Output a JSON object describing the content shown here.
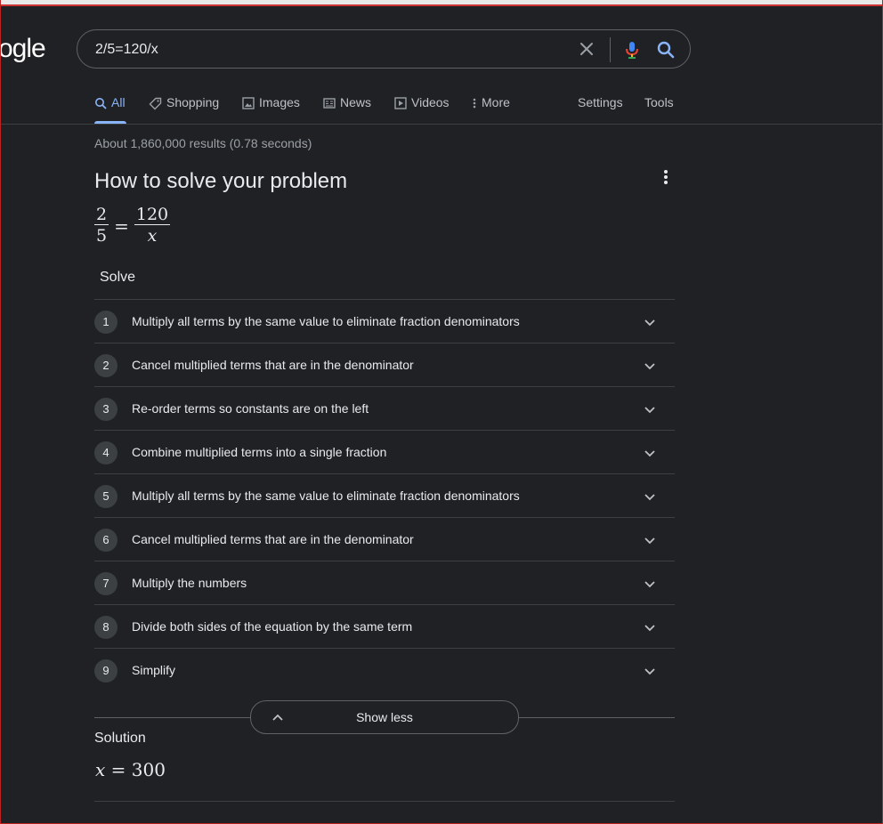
{
  "logo": {
    "text": "ogle"
  },
  "search": {
    "query": "2/5=120/x"
  },
  "tabs": [
    {
      "label": "All",
      "icon": "search-icon"
    },
    {
      "label": "Shopping",
      "icon": "tag-icon"
    },
    {
      "label": "Images",
      "icon": "image-icon"
    },
    {
      "label": "News",
      "icon": "news-icon"
    },
    {
      "label": "Videos",
      "icon": "play-icon"
    },
    {
      "label": "More",
      "icon": "more-vert-icon"
    }
  ],
  "tools": {
    "settings": "Settings",
    "tools": "Tools"
  },
  "stats": "About 1,860,000 results (0.78 seconds)",
  "panel": {
    "title": "How to solve your problem",
    "equation": {
      "lhs_num": "2",
      "lhs_den": "5",
      "eq": "=",
      "rhs_num": "120",
      "rhs_den": "x"
    },
    "solve_label": "Solve",
    "steps": [
      {
        "n": "1",
        "text": "Multiply all terms by the same value to eliminate fraction denominators"
      },
      {
        "n": "2",
        "text": "Cancel multiplied terms that are in the denominator"
      },
      {
        "n": "3",
        "text": "Re-order terms so constants are on the left"
      },
      {
        "n": "4",
        "text": "Combine multiplied terms into a single fraction"
      },
      {
        "n": "5",
        "text": "Multiply all terms by the same value to eliminate fraction denominators"
      },
      {
        "n": "6",
        "text": "Cancel multiplied terms that are in the denominator"
      },
      {
        "n": "7",
        "text": "Multiply the numbers"
      },
      {
        "n": "8",
        "text": "Divide both sides of the equation by the same term"
      },
      {
        "n": "9",
        "text": "Simplify"
      }
    ],
    "show_less": "Show less",
    "solution_label": "Solution",
    "solution": {
      "var": "x",
      "eq": "=",
      "value": "300"
    }
  },
  "colors": {
    "background": "#202124",
    "accent": "#8ab4f8",
    "text": "#e8eaed",
    "muted": "#9aa0a6"
  }
}
